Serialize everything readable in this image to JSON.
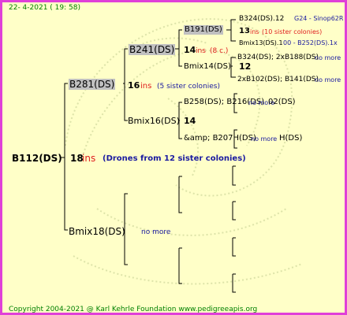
{
  "header": {
    "date_line": "22-  4-2021 ( 19: 58)"
  },
  "root": {
    "name": "B112(DS)",
    "ins_count": "18",
    "ins_word": "ins",
    "note": "(Drones from 12 sister colonies)"
  },
  "gen1": [
    {
      "name": "B281(DS)",
      "ins_count": "16",
      "ins_word": "ins",
      "note": "(5 sister colonies)"
    },
    {
      "name": "Bmix18(DS)",
      "note": "no more"
    }
  ],
  "gen2": [
    {
      "name": "B241(DS)",
      "ins_count": "14",
      "ins_word": "ins",
      "note": "(8 c.)"
    },
    {
      "name": "Bmix16(DS)",
      "ins_count": "14"
    }
  ],
  "gen3": [
    {
      "name": "B191(DS)"
    },
    {
      "name": "Bmix14(DS)",
      "ins_count": "12"
    },
    {
      "name": "B258(DS); B216(DS)",
      "note": "no more"
    },
    {
      "name": "&amp; B207H(DS)",
      "note": "no more"
    }
  ],
  "gen4": [
    {
      "name": "B324(DS).12",
      "extra": "G24 - Sinop62R"
    },
    {
      "ins_count": "13",
      "ins_word": "ins",
      "note": "(10 sister colonies)"
    },
    {
      "name": "Bmix13(DS).1",
      "extra": "00 - B252(DS).1x"
    },
    {
      "name": "B324(DS); 2xB188(DS)",
      "note": "no more"
    },
    {
      "name": "2xB102(DS); B141(DS)",
      "note": "no more"
    },
    {
      "gen3_note_a": "02(DS)",
      "gen3_note_b": "H(DS)"
    }
  ],
  "footer": {
    "copyright": "Copyright 2004-2021 @ Karl Kehrle Foundation    www.pedigreeapis.org"
  }
}
